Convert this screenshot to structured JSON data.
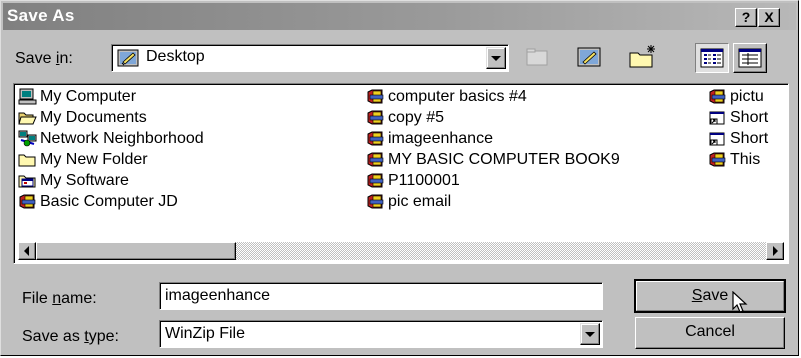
{
  "window": {
    "title": "Save As",
    "help_button": "?",
    "close_button": "X"
  },
  "save_in": {
    "label_prefix": "Save ",
    "label_accel": "i",
    "label_suffix": "n:",
    "value": "Desktop",
    "icon": "desktop-icon"
  },
  "toolbar": {
    "buttons": [
      "up-one-level",
      "desktop",
      "create-new-folder",
      "list-view",
      "details-view"
    ]
  },
  "files": [
    {
      "label": "My Computer",
      "icon": "computer-icon"
    },
    {
      "label": "My Documents",
      "icon": "folder-open-icon"
    },
    {
      "label": "Network Neighborhood",
      "icon": "network-icon"
    },
    {
      "label": "My New Folder",
      "icon": "folder-icon"
    },
    {
      "label": "My Software",
      "icon": "folder-window-icon"
    },
    {
      "label": "Basic Computer JD",
      "icon": "winzip-icon"
    },
    {
      "label": "computer basics #4",
      "icon": "winzip-icon"
    },
    {
      "label": "copy #5",
      "icon": "winzip-icon"
    },
    {
      "label": "imageenhance",
      "icon": "winzip-icon"
    },
    {
      "label": "MY BASIC COMPUTER BOOK9",
      "icon": "winzip-icon"
    },
    {
      "label": "P1100001",
      "icon": "winzip-icon"
    },
    {
      "label": "pic email",
      "icon": "winzip-icon"
    },
    {
      "label": "pictu",
      "icon": "winzip-icon"
    },
    {
      "label": "Short",
      "icon": "shortcut-icon"
    },
    {
      "label": "Short",
      "icon": "shortcut-icon"
    },
    {
      "label": "This",
      "icon": "winzip-icon"
    }
  ],
  "file_name": {
    "label_prefix": "File ",
    "label_accel": "n",
    "label_suffix": "ame:",
    "value": "imageenhance"
  },
  "save_as_type": {
    "label_prefix": "Save as ",
    "label_accel": "t",
    "label_suffix": "ype:",
    "value": "WinZip File"
  },
  "buttons": {
    "save_accel": "S",
    "save_rest": "ave",
    "cancel": "Cancel"
  }
}
